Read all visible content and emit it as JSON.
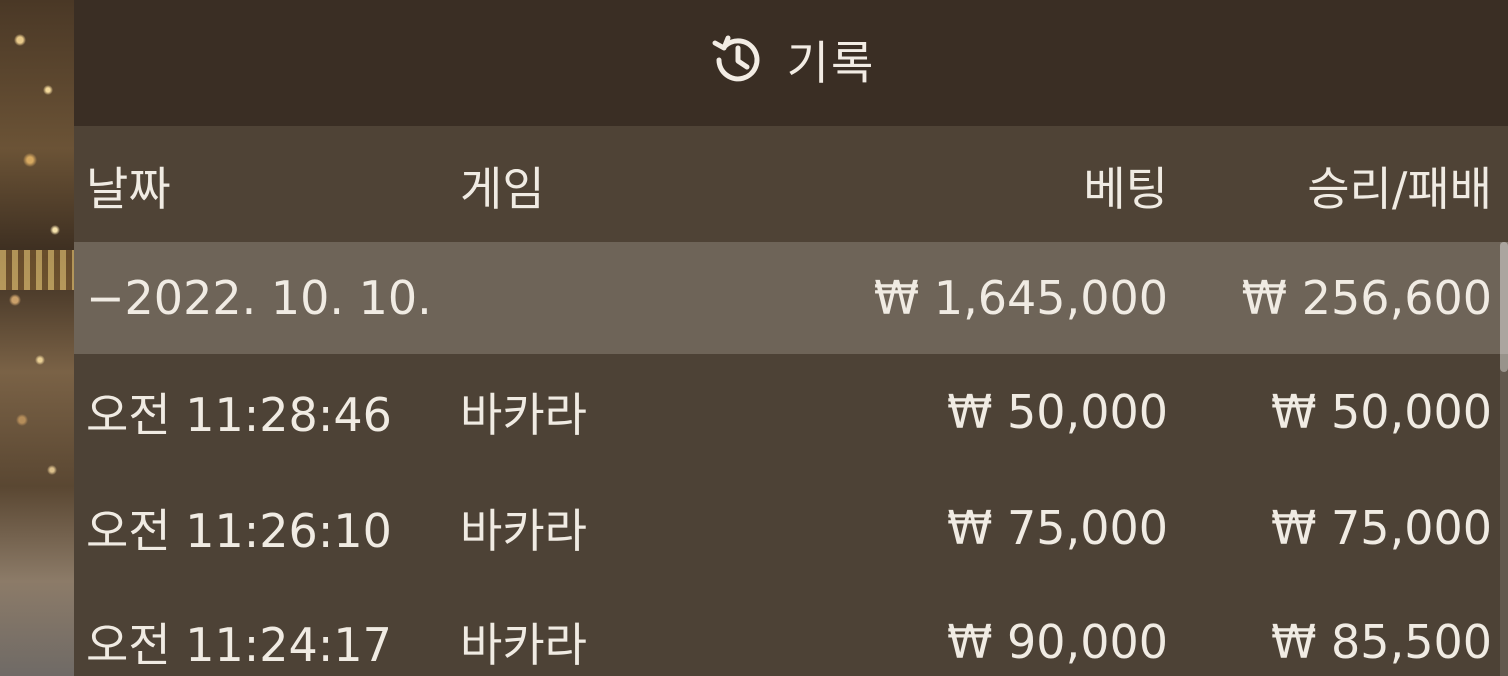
{
  "header": {
    "icon": "history-icon",
    "title": "기록"
  },
  "columns": {
    "date": "날짜",
    "game": "게임",
    "bet": "베팅",
    "win_loss": "승리/패배"
  },
  "date_group": {
    "date": "−2022. 10. 10.",
    "bet_total": "₩ 1,645,000",
    "win_total": "₩ 256,600"
  },
  "rows": [
    {
      "time": "오전 11:28:46",
      "game": "바카라",
      "bet": "₩ 50,000",
      "win": "₩ 50,000"
    },
    {
      "time": "오전 11:26:10",
      "game": "바카라",
      "bet": "₩ 75,000",
      "win": "₩ 75,000"
    },
    {
      "time": "오전 11:24:17",
      "game": "바카라",
      "bet": "₩ 90,000",
      "win": "₩ 85,500"
    }
  ],
  "colors": {
    "header_bg": "#3a2e24",
    "panel_bg": "#4d4236",
    "selected_row_bg": "#6e6458",
    "text": "#f0ebe3"
  }
}
